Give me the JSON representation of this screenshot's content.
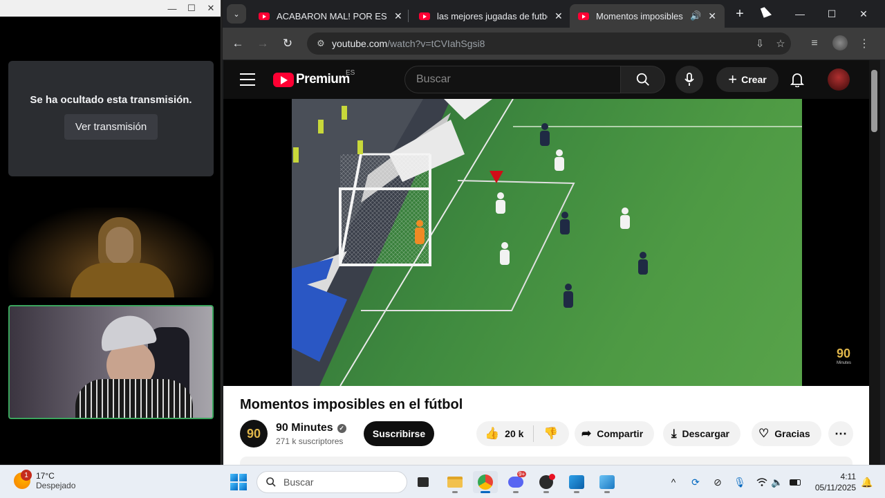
{
  "left_window": {
    "hidden_message": "Se ha ocultado esta transmisión.",
    "watch_button": "Ver transmisión"
  },
  "browser": {
    "tabs": [
      {
        "title": "ACABARON MAL! POR ESTE MO",
        "active": false
      },
      {
        "title": "las mejores jugadas de futbol",
        "active": false
      },
      {
        "title": "Momentos imposibles en el",
        "active": true
      }
    ],
    "url_host": "youtube.com",
    "url_path": "/watch?v=tCVIahSgsi8"
  },
  "youtube": {
    "logo_text": "Premium",
    "country_code": "ES",
    "search_placeholder": "Buscar",
    "create_label": "Crear",
    "video_title": "Momentos imposibles en el fútbol",
    "channel_name": "90 Minutes",
    "channel_subs": "271 k suscriptores",
    "channel_logo_text": "90",
    "subscribe_label": "Suscribirse",
    "likes": "20 k",
    "share_label": "Compartir",
    "download_label": "Descargar",
    "thanks_label": "Gracias",
    "watermark": "90",
    "watermark_sub": "Minutes"
  },
  "taskbar": {
    "weather_badge": "1",
    "temperature": "17°C",
    "weather_desc": "Despejado",
    "search_placeholder": "Buscar",
    "time": "4:11",
    "date": "05/11/2025",
    "discord_badge": "9+"
  }
}
